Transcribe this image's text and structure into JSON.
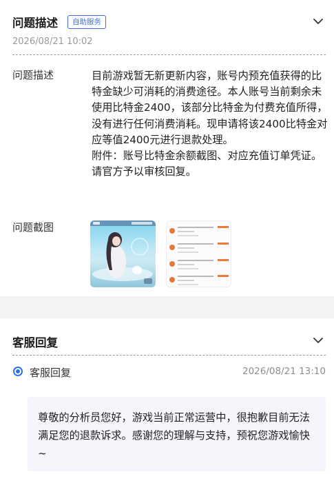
{
  "problem_section": {
    "title": "问题描述",
    "badge": "自助服务",
    "timestamp": "2026/08/21 10:02",
    "description_label": "问题描述",
    "description_text": "目前游戏暂无新更新内容，账号内预充值获得的比特金缺少可消耗的消费途径。本人账号当前剩余未使用比特金2400，该部分比特金为付费充值所得，没有进行任何消费消耗。现申请将该2400比特金对应等值2400元进行退款处理。",
    "attachment_text": "附件：账号比特金余额截图、对应充值订单凭证。请官方予以审核回复。",
    "screenshot_label": "问题截图",
    "chevron_icon": "chevron-down-icon"
  },
  "reply_section": {
    "title": "客服回复",
    "item_label": "客服回复",
    "timestamp": "2026/08/21 13:10",
    "reply_text": "尊敬的分析员您好，游戏当前正常运营中，很抱歉目前无法满足您的退款诉求。感谢您的理解与支持，预祝您游戏愉快~",
    "chevron_icon": "chevron-down-icon"
  },
  "colors": {
    "accent": "#3d6fe8",
    "order_amount": "#ee7a3a",
    "section_gap": "#f3f3f5",
    "reply_bg": "#f7f5fb"
  }
}
